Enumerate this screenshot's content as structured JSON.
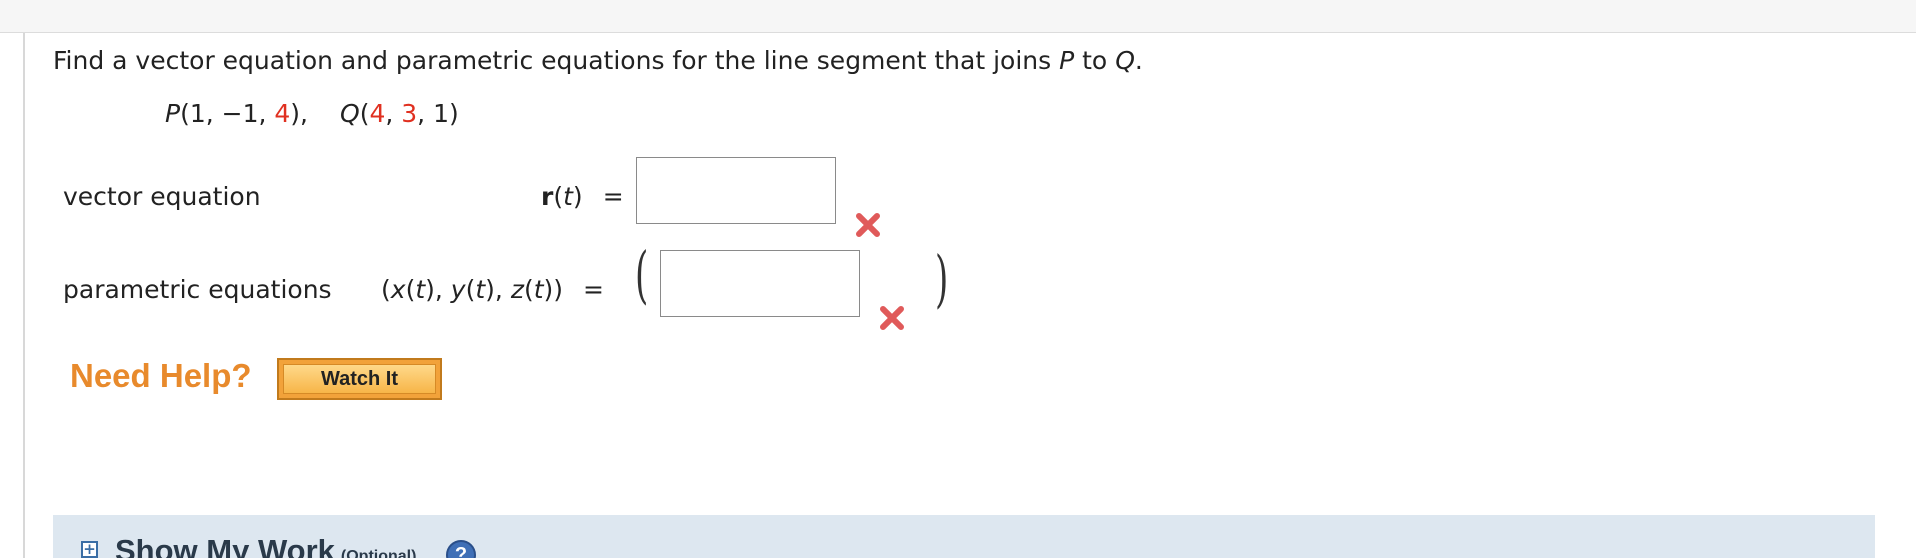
{
  "question": {
    "text_before_p": "Find a vector equation and parametric equations for the line segment that joins ",
    "p": "P",
    "text_middle": " to ",
    "q": "Q",
    "text_end": "."
  },
  "points": {
    "p_name": "P",
    "p_open": "(1, −1, ",
    "p_z": "4",
    "p_close": "),",
    "q_name": "Q",
    "q_open": "(",
    "q_x": "4",
    "q_sep1": ", ",
    "q_y": "3",
    "q_close": ", 1)"
  },
  "vector_equation": {
    "label": "vector equation",
    "lhs_bold": "r",
    "lhs_open": "(",
    "lhs_var": "t",
    "lhs_close": ")",
    "equals": "=",
    "answer_value": "",
    "status_icon": "incorrect-x-icon",
    "status_color": "#e05a5a"
  },
  "parametric_equations": {
    "label": "parametric equations",
    "lhs": "(x(t), y(t), z(t))",
    "x": "x",
    "y": "y",
    "z": "z",
    "t": "t",
    "equals": "=",
    "open_paren": "(",
    "close_paren": ")",
    "answer_value": "",
    "status_icon": "incorrect-x-icon",
    "status_color": "#e05a5a"
  },
  "help": {
    "need_help_label": "Need Help?",
    "watch_it_label": "Watch It",
    "accent_color": "#e88a2c"
  },
  "show_my_work": {
    "toggle_symbol": "+",
    "title": "Show My Work",
    "optional_label": "(Optional)",
    "help_symbol": "?"
  }
}
